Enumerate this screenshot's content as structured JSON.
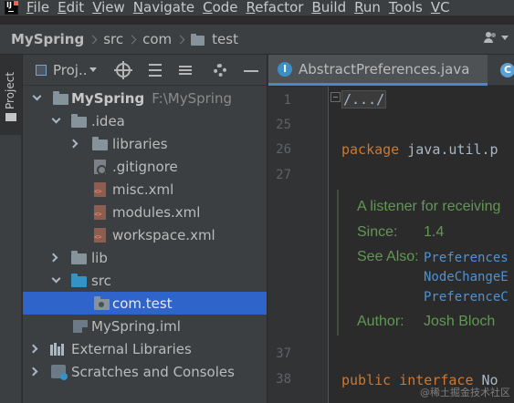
{
  "menubar": {
    "items": [
      {
        "mnemonic": "F",
        "rest": "ile"
      },
      {
        "mnemonic": "E",
        "rest": "dit"
      },
      {
        "mnemonic": "V",
        "rest": "iew"
      },
      {
        "mnemonic": "N",
        "rest": "avigate"
      },
      {
        "mnemonic": "C",
        "rest": "ode"
      },
      {
        "mnemonic": "R",
        "rest": "efactor"
      },
      {
        "mnemonic": "B",
        "rest": "uild"
      },
      {
        "mnemonic": "R",
        "rest": "un"
      },
      {
        "mnemonic": "T",
        "rest": "ools"
      },
      {
        "mnemonic": "V",
        "rest": "C"
      }
    ]
  },
  "navbar": {
    "crumbs": [
      "MySpring",
      "src",
      "com",
      "test"
    ]
  },
  "project_panel": {
    "title": "Proj..",
    "tree": [
      {
        "label": "MySpring",
        "path": "F:\\MySpring"
      },
      {
        "label": ".idea"
      },
      {
        "label": "libraries"
      },
      {
        "label": ".gitignore"
      },
      {
        "label": "misc.xml"
      },
      {
        "label": "modules.xml"
      },
      {
        "label": "workspace.xml"
      },
      {
        "label": "lib"
      },
      {
        "label": "src"
      },
      {
        "label": "com.test"
      },
      {
        "label": "MySpring.iml"
      },
      {
        "label": "External Libraries"
      },
      {
        "label": "Scratches and Consoles"
      }
    ]
  },
  "strip": {
    "tab_label": "Project"
  },
  "editor": {
    "tabs": [
      "AbstractPreferences.java",
      ""
    ],
    "line_numbers": [
      "1",
      "25",
      "26",
      "27",
      "37",
      "38"
    ],
    "code": {
      "folded": "/.../",
      "package_kw": "package",
      "package_rest": " java.util.p",
      "public_kw": "public",
      "interface_kw": "interface",
      "interface_rest": " No"
    },
    "doc": {
      "summary": "A listener for receiving",
      "since_label": "Since:",
      "since_value": "1.4",
      "see_also_label": "See Also:",
      "see_also": [
        "Preferences",
        "NodeChangeE",
        "PreferenceC"
      ],
      "author_label": "Author:",
      "author_value": "Josh Bloch"
    }
  },
  "watermark": "@稀土掘金技术社区",
  "colors": {
    "accent": "#2f65ca",
    "keyword": "#cc7832",
    "doc": "#629755",
    "link": "#4e92d3"
  }
}
